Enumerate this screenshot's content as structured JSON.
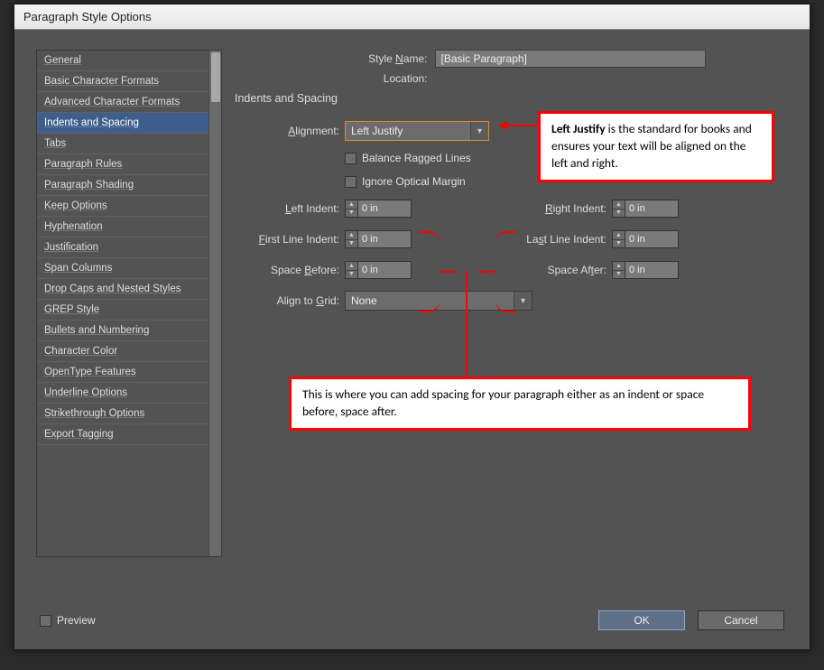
{
  "dialog": {
    "title": "Paragraph Style Options"
  },
  "sidebar": {
    "items": [
      {
        "label": "General"
      },
      {
        "label": "Basic Character Formats"
      },
      {
        "label": "Advanced Character Formats"
      },
      {
        "label": "Indents and Spacing"
      },
      {
        "label": "Tabs"
      },
      {
        "label": "Paragraph Rules"
      },
      {
        "label": "Paragraph Shading"
      },
      {
        "label": "Keep Options"
      },
      {
        "label": "Hyphenation"
      },
      {
        "label": "Justification"
      },
      {
        "label": "Span Columns"
      },
      {
        "label": "Drop Caps and Nested Styles"
      },
      {
        "label": "GREP Style"
      },
      {
        "label": "Bullets and Numbering"
      },
      {
        "label": "Character Color"
      },
      {
        "label": "OpenType Features"
      },
      {
        "label": "Underline Options"
      },
      {
        "label": "Strikethrough Options"
      },
      {
        "label": "Export Tagging"
      }
    ],
    "selected_index": 3
  },
  "header": {
    "style_name_label_pre": "Style ",
    "style_name_label_ul": "N",
    "style_name_label_post": "ame:",
    "style_name_value": "[Basic Paragraph]",
    "location_label": "Location:"
  },
  "section": {
    "title": "Indents and Spacing"
  },
  "fields": {
    "alignment_pre": "",
    "alignment_ul": "A",
    "alignment_post": "lignment:",
    "alignment_value": "Left Justify",
    "balance_label": "Balance Ragged Lines",
    "ignore_pre": "",
    "ignore_ul": "I",
    "ignore_post": "gnore Optical Margin",
    "left_indent_pre": "",
    "left_indent_ul": "L",
    "left_indent_post": "eft Indent:",
    "left_indent_value": "0 in",
    "right_indent_pre": "",
    "right_indent_ul": "R",
    "right_indent_post": "ight Indent:",
    "right_indent_value": "0 in",
    "first_line_pre": "",
    "first_line_ul": "F",
    "first_line_post": "irst Line Indent:",
    "first_line_value": "0 in",
    "last_line_pre": "La",
    "last_line_ul": "s",
    "last_line_post": "t Line Indent:",
    "last_line_value": "0 in",
    "space_before_pre": "Space ",
    "space_before_ul": "B",
    "space_before_post": "efore:",
    "space_before_value": "0 in",
    "space_after_pre": "Space Af",
    "space_after_ul": "t",
    "space_after_post": "er:",
    "space_after_value": "0 in",
    "align_grid_pre": "Align to ",
    "align_grid_ul": "G",
    "align_grid_post": "rid:",
    "align_grid_value": "None"
  },
  "callouts": {
    "c1_b": "Left Justify",
    "c1_rest": " is the standard for books and ensures your text will be aligned on the left and right.",
    "c2": "This is where you can add spacing for your paragraph either as an indent or space before, space after."
  },
  "footer": {
    "preview_ul": "P",
    "preview_post": "review",
    "ok": "OK",
    "cancel": "Cancel"
  }
}
